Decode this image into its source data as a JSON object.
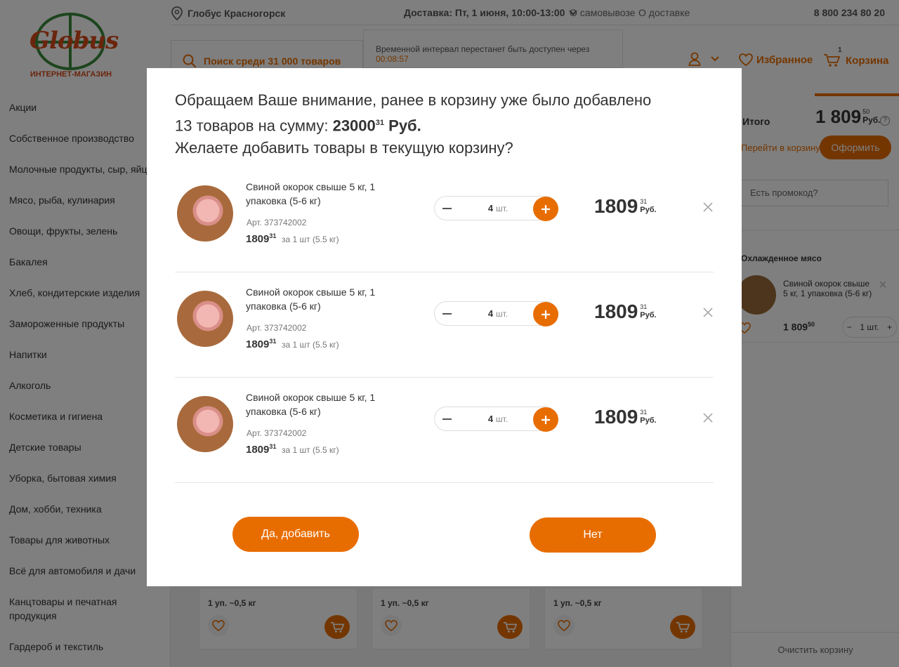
{
  "header": {
    "logo_text": "Globus",
    "logo_subtitle": "ИНТЕРНЕТ-МАГАЗИН",
    "location": "Глобус Красногорск",
    "delivery": "Доставка: Пт, 1 июня, 10:00-13:00",
    "pickup": "О самовывозе",
    "delivery_info": "О доставке",
    "phone": "8 800 234 80 20",
    "tooltip_text": "Временной интервал перестанет быть доступен через",
    "tooltip_timer": "00:08:57",
    "search_placeholder": "Поиск среди 31 000 товаров",
    "favorites": "Избранное",
    "cart": "Корзина",
    "cart_count": "1",
    "accent_color": "#e86d00"
  },
  "sidebar": {
    "categories": [
      "Акции",
      "Собственное производство",
      "Молочные продукты, сыр, яйца",
      "Мясо, рыба, кулинария",
      "Овощи, фрукты, зелень",
      "Бакалея",
      "Хлеб, кондитерские изделия",
      "Замороженные продукты",
      "Напитки",
      "Алкоголь",
      "Косметика и гигиена",
      "Детские товары",
      "Уборка, бытовая химия",
      "Дом, хобби, техника",
      "Товары для животных",
      "Всё для автомобиля и дачи",
      "Канцтовары и печатная продукция",
      "Гардероб и текстиль"
    ]
  },
  "grid": {
    "cards": [
      {
        "pack": "1 уп. ~0,5 кг"
      },
      {
        "pack": "1 уп. ~0,5 кг"
      },
      {
        "pack": "1 уп. ~0,5 кг"
      }
    ]
  },
  "cart_panel": {
    "total_label": "Итого",
    "total_int": "1 809",
    "total_cents": "50",
    "currency": "Руб.",
    "help_icon": "?",
    "to_cart": "Перейти в корзину",
    "checkout": "Оформить",
    "promo_placeholder": "Есть промокод?",
    "category": "Охлажденное мясо",
    "item_name": "Свиной окорок свыше 5 кг, 1 упаковка (5-6 кг)",
    "item_price_int": "1 809",
    "item_price_cents": "50",
    "item_qty": "1 шт.",
    "minus": "−",
    "plus": "+",
    "close": "×",
    "clear": "Очистить корзину"
  },
  "modal": {
    "title_line1": "Обращаем Ваше внимание, ранее в корзину уже было добавлено",
    "title_line2_pre": "13 товаров на сумму: ",
    "title_sum_int": "23000",
    "title_sum_cents": "31",
    "title_sum_currency": "Руб.",
    "title_line3": "Желаете добавить товары в текущую корзину?",
    "items": [
      {
        "name": "Свиной окорок свыше 5 кг, 1 упаковка (5-6 кг)",
        "art": "Арт. 373742002",
        "price_int": "1809",
        "price_cents": "31",
        "per": "за 1 шт (5.5 кг)",
        "qty": "4",
        "unit": "шт.",
        "total_int": "1809",
        "total_cents": "31",
        "currency": "Руб."
      },
      {
        "name": "Свиной окорок свыше 5 кг, 1 упаковка (5-6 кг)",
        "art": "Арт. 373742002",
        "price_int": "1809",
        "price_cents": "31",
        "per": "за 1 шт (5.5 кг)",
        "qty": "4",
        "unit": "шт.",
        "total_int": "1809",
        "total_cents": "31",
        "currency": "Руб."
      },
      {
        "name": "Свиной окорок свыше 5 кг, 1 упаковка (5-6 кг)",
        "art": "Арт. 373742002",
        "price_int": "1809",
        "price_cents": "31",
        "per": "за 1 шт (5.5 кг)",
        "qty": "4",
        "unit": "шт.",
        "total_int": "1809",
        "total_cents": "31",
        "currency": "Руб."
      }
    ],
    "yes_button": "Да, добавить",
    "no_button": "Нет"
  }
}
